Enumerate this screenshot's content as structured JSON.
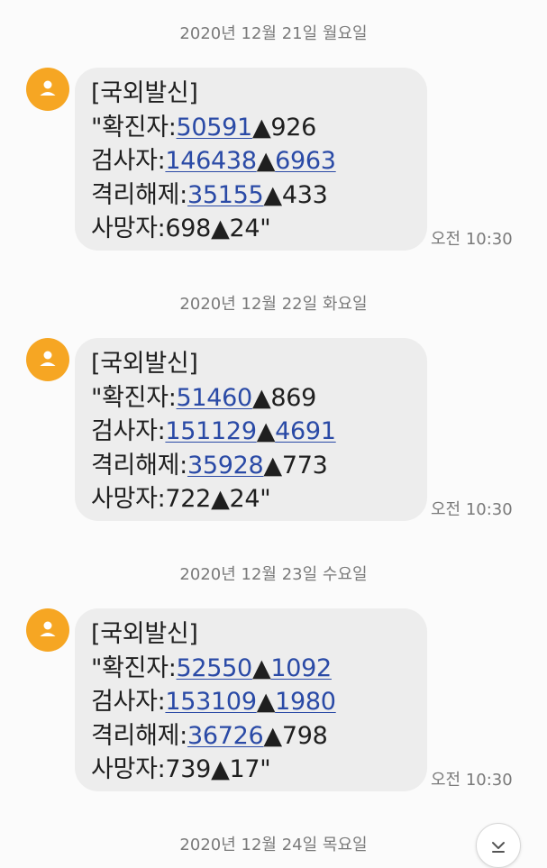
{
  "accent_color": "#f6a623",
  "link_color": "#2a4aa6",
  "dates": [
    "2020년 12월 21일 월요일",
    "2020년 12월 22일 화요일",
    "2020년 12월 23일 수요일",
    "2020년 12월 24일 목요일"
  ],
  "messages": [
    {
      "header": "[국외발신]",
      "confirmed_label": "\"확진자:",
      "confirmed_value": "50591",
      "confirmed_delta": "926",
      "tested_label": "검사자:",
      "tested_value": "146438",
      "tested_delta": "6963",
      "released_label": "격리해제:",
      "released_value": "35155",
      "released_delta": "433",
      "deaths_label": "사망자:",
      "deaths_value": "698",
      "deaths_delta": "24\"",
      "time": "오전 10:30"
    },
    {
      "header": "[국외발신]",
      "confirmed_label": "\"확진자:",
      "confirmed_value": "51460",
      "confirmed_delta": "869",
      "tested_label": "검사자:",
      "tested_value": "151129",
      "tested_delta": "4691",
      "released_label": "격리해제:",
      "released_value": "35928",
      "released_delta": "773",
      "deaths_label": "사망자:",
      "deaths_value": "722",
      "deaths_delta": "24\"",
      "time": "오전 10:30"
    },
    {
      "header": "[국외발신]",
      "confirmed_label": "\"확진자:",
      "confirmed_value": "52550",
      "confirmed_delta": "1092",
      "tested_label": "검사자:",
      "tested_value": "153109",
      "tested_delta": "1980",
      "released_label": "격리해제:",
      "released_value": "36726",
      "released_delta": "798",
      "deaths_label": "사망자:",
      "deaths_value": "739",
      "deaths_delta": "17\"",
      "time": "오전 10:30"
    }
  ],
  "triangle": "▲",
  "icons": {
    "avatar": "person-icon",
    "scroll": "chevron-down-icon"
  }
}
